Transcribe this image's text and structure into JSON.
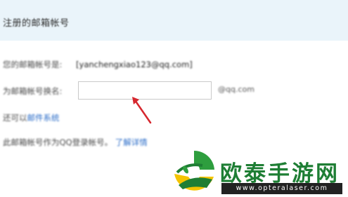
{
  "header": {
    "title": "注册的邮箱帐号"
  },
  "form": {
    "current_email_label": "您的邮箱帐号是:",
    "current_email_value": "[yanchengxiao123@qq.com]",
    "new_email_label": "为邮箱帐号换名:",
    "new_email_value": "",
    "email_suffix": "@qq.com",
    "help_prefix": "还可以",
    "help_link": "邮件系统",
    "info_text": "此邮箱帐号作为QQ登录帐号。",
    "info_link": "了解详情"
  },
  "watermark": {
    "brand": "欧泰手游网",
    "url": "www.opteralaser.com",
    "colors": {
      "green": "#1e7e34",
      "dark": "#222222"
    }
  },
  "annotation": {
    "arrow_color": "#d6272e"
  }
}
